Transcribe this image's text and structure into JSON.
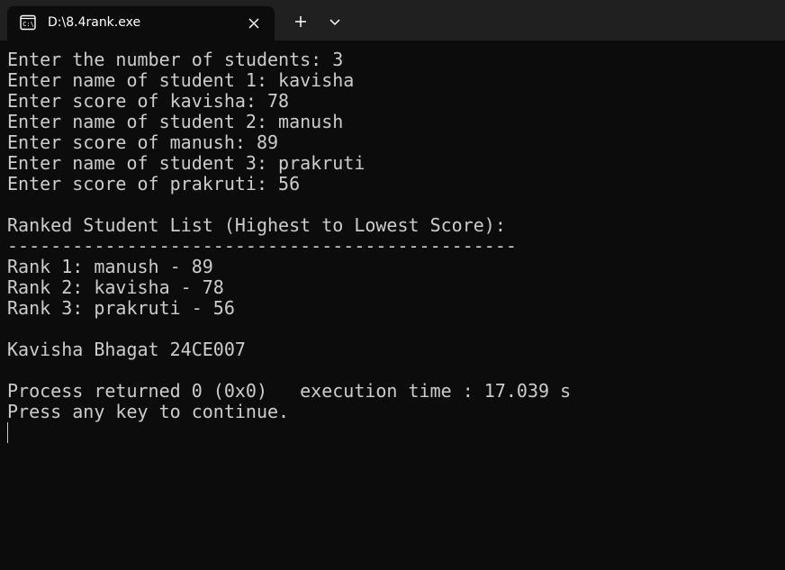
{
  "window": {
    "tab_title": "D:\\8.4rank.exe",
    "tab_icon": "console-icon",
    "colors": {
      "background": "#0c0c0c",
      "titlebar": "#202020",
      "text": "#cccccc"
    }
  },
  "console": {
    "lines": [
      "Enter the number of students: 3",
      "Enter name of student 1: kavisha",
      "Enter score of kavisha: 78",
      "Enter name of student 2: manush",
      "Enter score of manush: 89",
      "Enter name of student 3: prakruti",
      "Enter score of prakruti: 56",
      "",
      "Ranked Student List (Highest to Lowest Score):",
      "-----------------------------------------------",
      "Rank 1: manush - 89",
      "Rank 2: kavisha - 78",
      "Rank 3: prakruti - 56",
      "",
      "Kavisha Bhagat 24CE007",
      "",
      "Process returned 0 (0x0)   execution time : 17.039 s",
      "Press any key to continue."
    ]
  }
}
